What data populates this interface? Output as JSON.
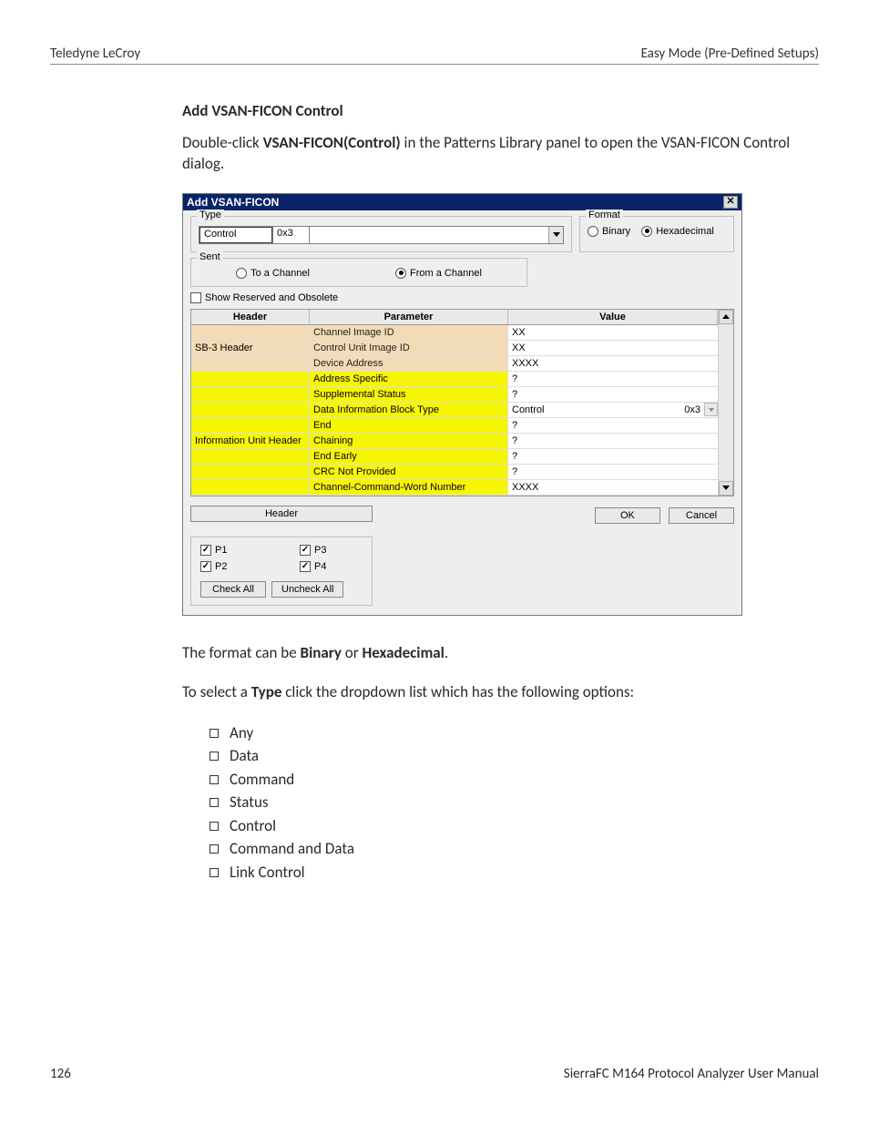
{
  "header": {
    "left": "Teledyne LeCroy",
    "right": "Easy Mode (Pre-Defined Setups)"
  },
  "section_title": "Add VSAN-FICON Control",
  "intro_pre": "Double-click ",
  "intro_bold": "VSAN-FICON(Control)",
  "intro_post": " in the Patterns Library panel to open the VSAN-FICON Control dialog.",
  "dialog": {
    "title": "Add VSAN-FICON",
    "type_label": "Type",
    "type_name": "Control",
    "type_code": "0x3",
    "format_label": "Format",
    "format_binary": "Binary",
    "format_hex": "Hexadecimal",
    "sent_label": "Sent",
    "sent_to": "To a Channel",
    "sent_from": "From a Channel",
    "reserved_label": "Show Reserved and Obsolete",
    "cols": {
      "header": "Header",
      "param": "Parameter",
      "value": "Value"
    },
    "rows": [
      {
        "hdr": "",
        "param": "Channel Image ID",
        "val": "XX",
        "paramClass": ""
      },
      {
        "hdr": "SB-3 Header",
        "param": "Control Unit Image ID",
        "val": "XX",
        "paramClass": ""
      },
      {
        "hdr": "",
        "param": "Device Address",
        "val": "XXXX",
        "paramClass": ""
      },
      {
        "hdr": "",
        "param": "Address Specific",
        "val": "?",
        "paramClass": "yellow"
      },
      {
        "hdr": "",
        "param": "Supplemental Status",
        "val": "?",
        "paramClass": "yellow"
      },
      {
        "hdr": "",
        "param": "Data Information Block Type",
        "val": "Control",
        "paramClass": "yellow",
        "combo": true,
        "comboCode": "0x3"
      },
      {
        "hdr": "",
        "param": "End",
        "val": "?",
        "paramClass": "yellow"
      },
      {
        "hdr": "Information Unit Header",
        "param": "Chaining",
        "val": "?",
        "paramClass": "yellow",
        "headerYellow": true
      },
      {
        "hdr": "",
        "param": "End Early",
        "val": "?",
        "paramClass": "yellow"
      },
      {
        "hdr": "",
        "param": "CRC Not Provided",
        "val": "?",
        "paramClass": "yellow"
      },
      {
        "hdr": "",
        "param": "Channel-Command-Word Number",
        "val": "XXXX",
        "paramClass": "yellow"
      }
    ],
    "header_button": "Header",
    "ports": {
      "p1": "P1",
      "p2": "P2",
      "p3": "P3",
      "p4": "P4"
    },
    "check_all": "Check All",
    "uncheck_all": "Uncheck All",
    "ok": "OK",
    "cancel": "Cancel"
  },
  "after1_pre": "The format can be ",
  "after1_b1": "Binary",
  "after1_mid": " or ",
  "after1_b2": "Hexadecimal",
  "after1_post": ".",
  "after2_pre": "To select a ",
  "after2_b": "Type",
  "after2_post": " click the dropdown list which has the following options:",
  "options": [
    "Any",
    "Data",
    "Command",
    "Status",
    "Control",
    "Command and Data",
    "Link Control"
  ],
  "footer": {
    "page": "126",
    "manual": "SierraFC M164 Protocol Analyzer User Manual"
  }
}
